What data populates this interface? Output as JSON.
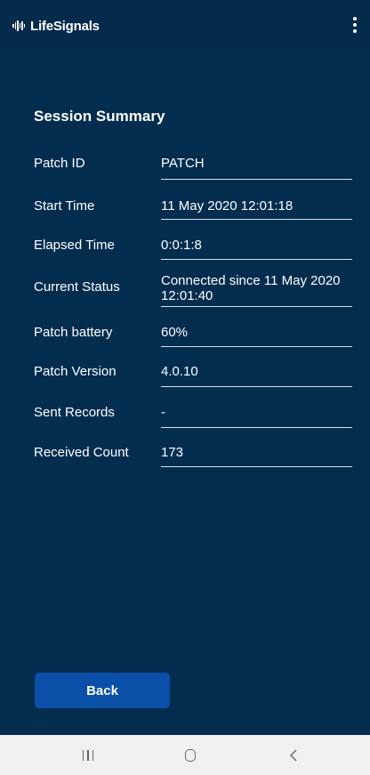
{
  "appbar": {
    "brand_name": "LifeSignals",
    "menu_icon": "more-vertical-icon",
    "logo_icon": "waveform-icon"
  },
  "summary": {
    "title": "Session Summary",
    "rows": [
      {
        "label": "Patch ID",
        "value": "PATCH"
      },
      {
        "label": "Start Time",
        "value": "11 May 2020 12:01:18"
      },
      {
        "label": "Elapsed Time",
        "value": "0:0:1:8"
      },
      {
        "label": "Current Status",
        "value": "Connected since 11 May 2020 12:01:40"
      },
      {
        "label": "Patch battery",
        "value": "60%"
      },
      {
        "label": "Patch Version",
        "value": "4.0.10"
      },
      {
        "label": "Sent Records",
        "value": "-"
      },
      {
        "label": "Received Count",
        "value": "173"
      }
    ]
  },
  "actions": {
    "back_label": "Back"
  },
  "system_nav": {
    "recents_icon": "recents-icon",
    "home_icon": "home-icon",
    "back_icon": "back-chevron-icon"
  },
  "colors": {
    "background": "#032d4f",
    "button": "#0a4fa8",
    "divider": "#d8e0e8",
    "navbar": "#f0f0f0"
  }
}
